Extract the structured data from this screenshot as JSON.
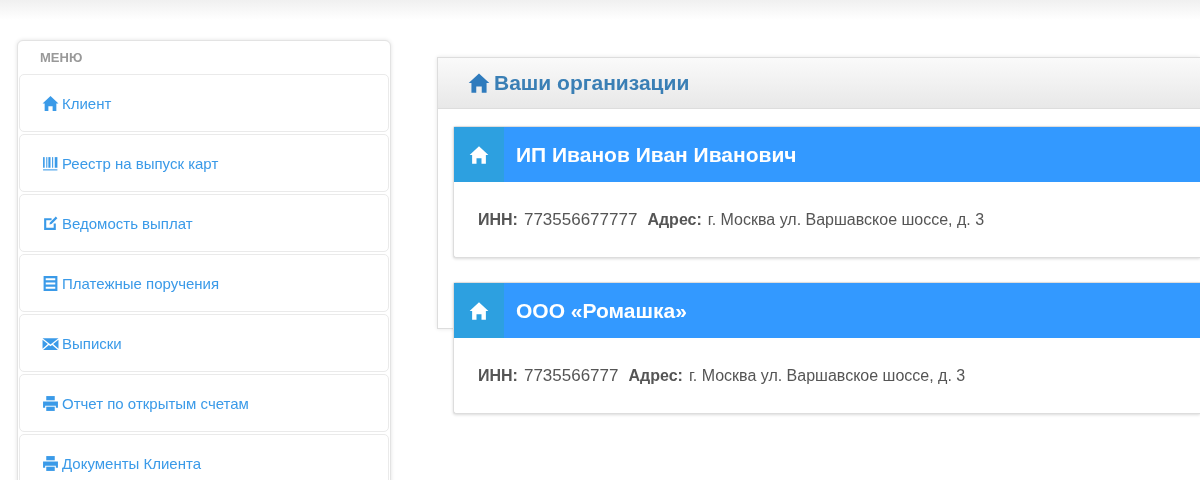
{
  "menu": {
    "title": "МЕНЮ",
    "items": [
      {
        "label": "Клиент",
        "kind": "home"
      },
      {
        "label": "Реестр на выпуск карт",
        "kind": "barcode"
      },
      {
        "label": "Ведомость выплат",
        "kind": "edit"
      },
      {
        "label": "Платежные поручения",
        "kind": "list"
      },
      {
        "label": "Выписки",
        "kind": "envelope"
      },
      {
        "label": "Отчет по открытым счетам",
        "kind": "print"
      },
      {
        "label": "Документы Клиента",
        "kind": "print"
      }
    ]
  },
  "organizations": {
    "title": "Ваши организации",
    "items": [
      {
        "name": "ИП Иванов Иван Иванович",
        "inn_label": "ИНН:",
        "inn": "773556677777",
        "address_label": "Адрес:",
        "address": "г. Москва ул. Варшавское шоссе, д. 3"
      },
      {
        "name": "ООО «Ромашка»",
        "inn_label": "ИНН:",
        "inn": "7735566777",
        "address_label": "Адрес:",
        "address": "г. Москва ул. Варшавское шоссе, д. 3"
      }
    ]
  }
}
